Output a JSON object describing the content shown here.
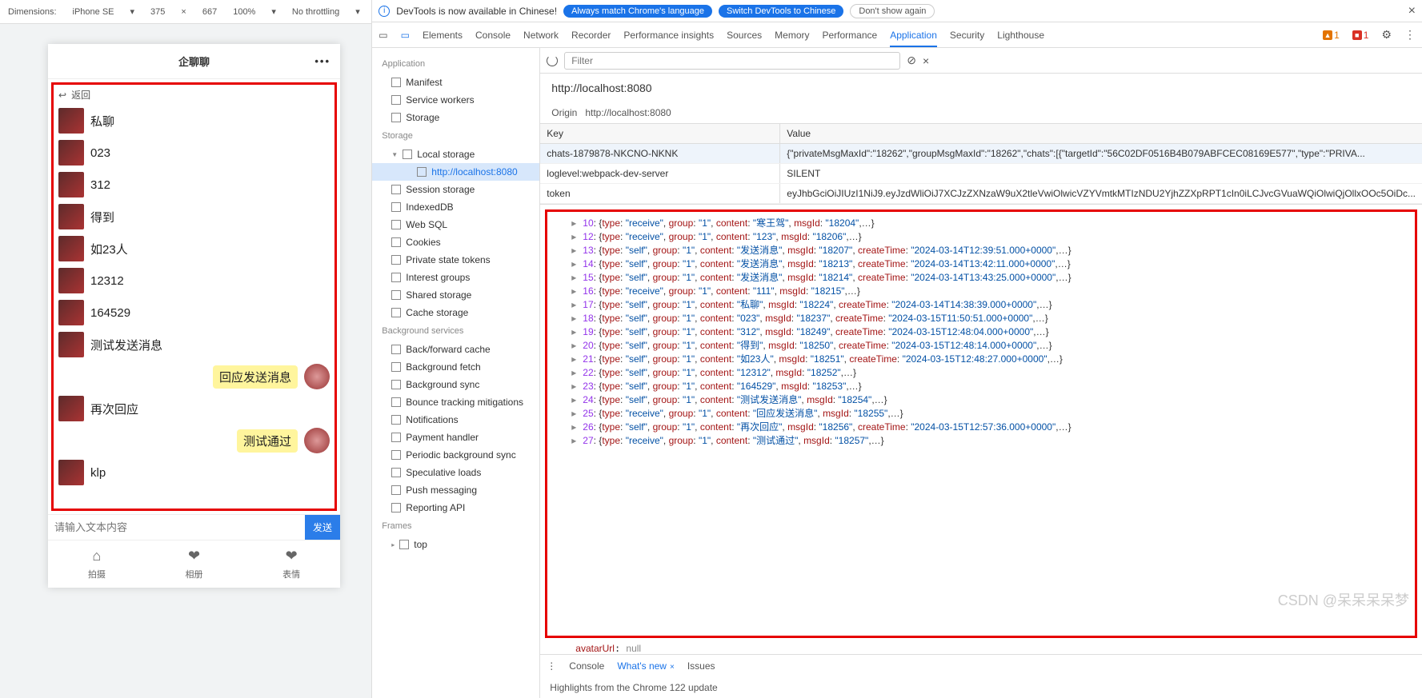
{
  "device_toolbar": {
    "dim_label": "Dimensions:",
    "device": "iPhone SE",
    "w": "375",
    "h": "667",
    "zoom": "100%",
    "throttle": "No throttling"
  },
  "app": {
    "title": "企聊聊",
    "back": "返回",
    "messages": [
      {
        "side": "left",
        "text": "私聊"
      },
      {
        "side": "left",
        "text": "023"
      },
      {
        "side": "left",
        "text": "312"
      },
      {
        "side": "left",
        "text": "得到"
      },
      {
        "side": "left",
        "text": "如23人"
      },
      {
        "side": "left",
        "text": "12312"
      },
      {
        "side": "left",
        "text": "164529"
      },
      {
        "side": "left",
        "text": "测试发送消息"
      },
      {
        "side": "right",
        "text": "回应发送消息",
        "hl": true
      },
      {
        "side": "left",
        "text": "再次回应"
      },
      {
        "side": "right",
        "text": "测试通过",
        "hl": true
      },
      {
        "side": "left",
        "text": "klp"
      }
    ],
    "placeholder": "请输入文本内容",
    "send": "发送",
    "nav": [
      {
        "ico": "⌂",
        "label": "拍摄"
      },
      {
        "ico": "❤",
        "label": "相册"
      },
      {
        "ico": "❤",
        "label": "表情"
      }
    ]
  },
  "banner": {
    "text": "DevTools is now available in Chinese!",
    "b1": "Always match Chrome's language",
    "b2": "Switch DevTools to Chinese",
    "b3": "Don't show again"
  },
  "tabs": {
    "items": [
      "Elements",
      "Console",
      "Network",
      "Recorder",
      "Performance insights",
      "Sources",
      "Memory",
      "Performance",
      "Application",
      "Security",
      "Lighthouse"
    ],
    "active": "Application",
    "warn": "1",
    "err": "1"
  },
  "sidebar": {
    "app_h": "Application",
    "app": [
      "Manifest",
      "Service workers",
      "Storage"
    ],
    "storage_h": "Storage",
    "local": "Local storage",
    "local_host": "http://localhost:8080",
    "storage": [
      "Session storage",
      "IndexedDB",
      "Web SQL",
      "Cookies",
      "Private state tokens",
      "Interest groups",
      "Shared storage",
      "Cache storage"
    ],
    "bg_h": "Background services",
    "bg": [
      "Back/forward cache",
      "Background fetch",
      "Background sync",
      "Bounce tracking mitigations",
      "Notifications",
      "Payment handler",
      "Periodic background sync",
      "Speculative loads",
      "Push messaging",
      "Reporting API"
    ],
    "frames_h": "Frames",
    "frames": "top"
  },
  "content": {
    "filter_ph": "Filter",
    "url": "http://localhost:8080",
    "origin_label": "Origin",
    "origin": "http://localhost:8080",
    "key_h": "Key",
    "val_h": "Value",
    "rows": [
      {
        "k": "chats-1879878-NKCNO-NKNK",
        "v": "{\"privateMsgMaxId\":\"18262\",\"groupMsgMaxId\":\"18262\",\"chats\":[{\"targetId\":\"56C02DF0516B4B079ABFCEC08169E577\",\"type\":\"PRIVA..."
      },
      {
        "k": "loglevel:webpack-dev-server",
        "v": "SILENT"
      },
      {
        "k": "token",
        "v": "eyJhbGciOiJIUzI1NiJ9.eyJzdWliOiJ7XCJzZXNzaW9uX2tleVwiOlwicVZYVmtkMTIzNDU2YjhZZXpRPT1cIn0iLCJvcGVuaWQiOlwiQjOllxOOc5OiDc..."
      }
    ]
  },
  "console": [
    {
      "i": "10",
      "t": "receive",
      "g": "1",
      "c": "寒王驾",
      "m": "18204",
      "tail": ",…}"
    },
    {
      "i": "12",
      "t": "receive",
      "g": "1",
      "c": "123",
      "m": "18206",
      "tail": ",…}"
    },
    {
      "i": "13",
      "t": "self",
      "g": "1",
      "c": "发送消息",
      "m": "18207",
      "ct": "2024-03-14T12:39:51.000+0000",
      "tail": ",…}"
    },
    {
      "i": "14",
      "t": "self",
      "g": "1",
      "c": "发送消息",
      "m": "18213",
      "ct": "2024-03-14T13:42:11.000+0000",
      "tail": ",…}"
    },
    {
      "i": "15",
      "t": "self",
      "g": "1",
      "c": "发送消息",
      "m": "18214",
      "ct": "2024-03-14T13:43:25.000+0000",
      "tail": ",…}"
    },
    {
      "i": "16",
      "t": "receive",
      "g": "1",
      "c": "111",
      "m": "18215",
      "tail": ",…}"
    },
    {
      "i": "17",
      "t": "self",
      "g": "1",
      "c": "私聊",
      "m": "18224",
      "ct": "2024-03-14T14:38:39.000+0000",
      "tail": ",…}"
    },
    {
      "i": "18",
      "t": "self",
      "g": "1",
      "c": "023",
      "m": "18237",
      "ct": "2024-03-15T11:50:51.000+0000",
      "tail": ",…}"
    },
    {
      "i": "19",
      "t": "self",
      "g": "1",
      "c": "312",
      "m": "18249",
      "ct": "2024-03-15T12:48:04.000+0000",
      "tail": ",…}"
    },
    {
      "i": "20",
      "t": "self",
      "g": "1",
      "c": "得到",
      "m": "18250",
      "ct": "2024-03-15T12:48:14.000+0000",
      "tail": ",…}"
    },
    {
      "i": "21",
      "t": "self",
      "g": "1",
      "c": "如23人",
      "m": "18251",
      "ct": "2024-03-15T12:48:27.000+0000",
      "tail": ",…}"
    },
    {
      "i": "22",
      "t": "self",
      "g": "1",
      "c": "12312",
      "m": "18252",
      "tail": ",…}"
    },
    {
      "i": "23",
      "t": "self",
      "g": "1",
      "c": "164529",
      "m": "18253",
      "tail": ",…}"
    },
    {
      "i": "24",
      "t": "self",
      "g": "1",
      "c": "测试发送消息",
      "m": "18254",
      "tail": ",…}"
    },
    {
      "i": "25",
      "t": "receive",
      "g": "1",
      "c": "回应发送消息",
      "m": "18255",
      "tail": ",…}"
    },
    {
      "i": "26",
      "t": "self",
      "g": "1",
      "c": "再次回应",
      "m": "18256",
      "ct": "2024-03-15T12:57:36.000+0000",
      "tail": ",…}"
    },
    {
      "i": "27",
      "t": "receive",
      "g": "1",
      "c": "测试通过",
      "m": "18257",
      "tail": ",…}"
    }
  ],
  "avatar_line": {
    "key": "avatarUrl",
    "val": "null"
  },
  "drawer": {
    "tabs": [
      "Console",
      "What's new",
      "Issues"
    ],
    "active": "What's new",
    "body": "Highlights from the Chrome 122 update"
  },
  "watermark": "CSDN @呆呆呆呆梦"
}
